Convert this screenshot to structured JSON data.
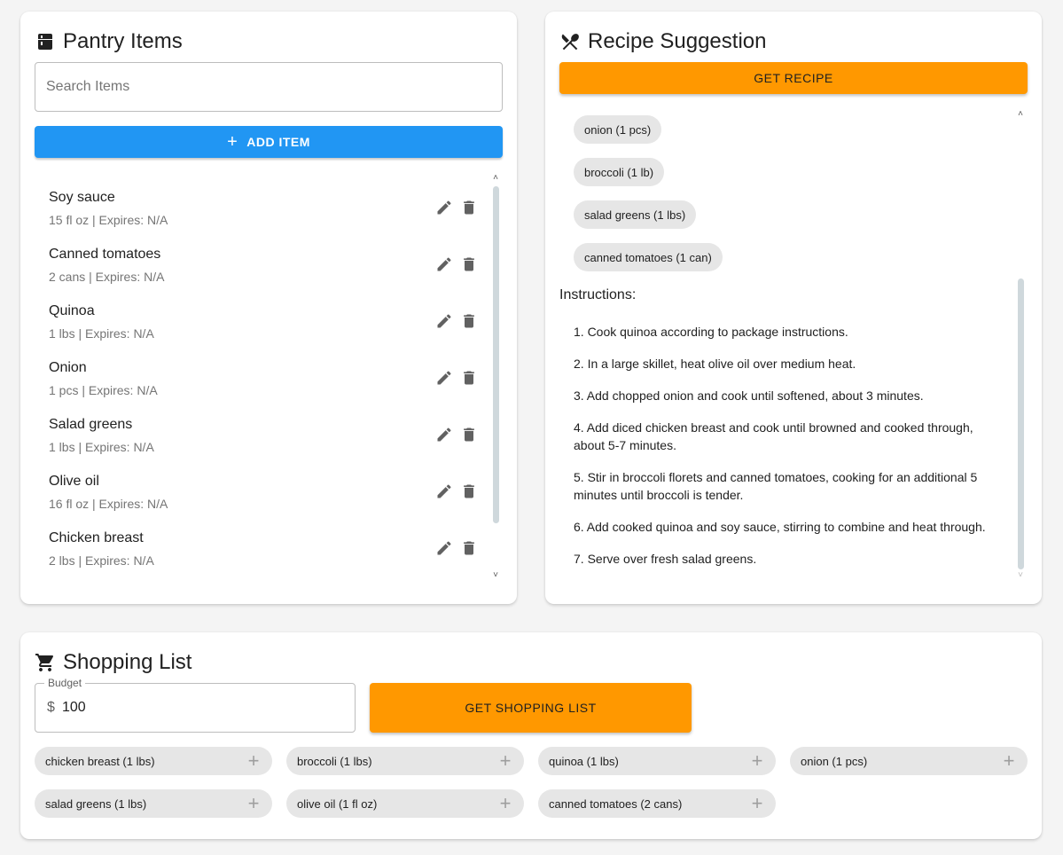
{
  "pantry": {
    "title": "Pantry Items",
    "search_placeholder": "Search Items",
    "search_value": "",
    "add_label": "ADD ITEM",
    "items": [
      {
        "name": "Soy sauce",
        "meta": "15 fl oz | Expires: N/A"
      },
      {
        "name": "Canned tomatoes",
        "meta": "2 cans | Expires: N/A"
      },
      {
        "name": "Quinoa",
        "meta": "1 lbs | Expires: N/A"
      },
      {
        "name": "Onion",
        "meta": "1 pcs | Expires: N/A"
      },
      {
        "name": "Salad greens",
        "meta": "1 lbs | Expires: N/A"
      },
      {
        "name": "Olive oil",
        "meta": "16 fl oz | Expires: N/A"
      },
      {
        "name": "Chicken breast",
        "meta": "2 lbs | Expires: N/A"
      }
    ]
  },
  "recipe": {
    "title": "Recipe Suggestion",
    "button_label": "GET RECIPE",
    "ingredients": [
      "onion (1 pcs)",
      "broccoli (1 lb)",
      "salad greens (1 lbs)",
      "canned tomatoes (1 can)"
    ],
    "instructions_heading": "Instructions:",
    "instructions": [
      "1. Cook quinoa according to package instructions.",
      "2. In a large skillet, heat olive oil over medium heat.",
      "3. Add chopped onion and cook until softened, about 3 minutes.",
      "4. Add diced chicken breast and cook until browned and cooked through, about 5-7 minutes.",
      "5. Stir in broccoli florets and canned tomatoes, cooking for an additional 5 minutes until broccoli is tender.",
      "6. Add cooked quinoa and soy sauce, stirring to combine and heat through.",
      "7. Serve over fresh salad greens."
    ]
  },
  "shopping": {
    "title": "Shopping List",
    "budget_label": "Budget",
    "budget_prefix": "$",
    "budget_value": "100",
    "button_label": "GET SHOPPING LIST",
    "items": [
      "chicken breast (1 lbs)",
      "broccoli (1 lbs)",
      "quinoa (1 lbs)",
      "onion (1 pcs)",
      "salad greens (1 lbs)",
      "olive oil (1 fl oz)",
      "canned tomatoes (2 cans)"
    ]
  },
  "colors": {
    "primary_blue": "#2196f3",
    "accent_orange": "#ff9800",
    "chip_gray": "#e6e6e6",
    "icon_gray": "#616161"
  },
  "icons": {
    "pantry_title": "fridge-icon",
    "recipe_title": "utensils-icon",
    "shopping_title": "shopping-cart-icon",
    "add": "plus-icon",
    "edit": "pencil-icon",
    "delete": "trash-icon"
  }
}
